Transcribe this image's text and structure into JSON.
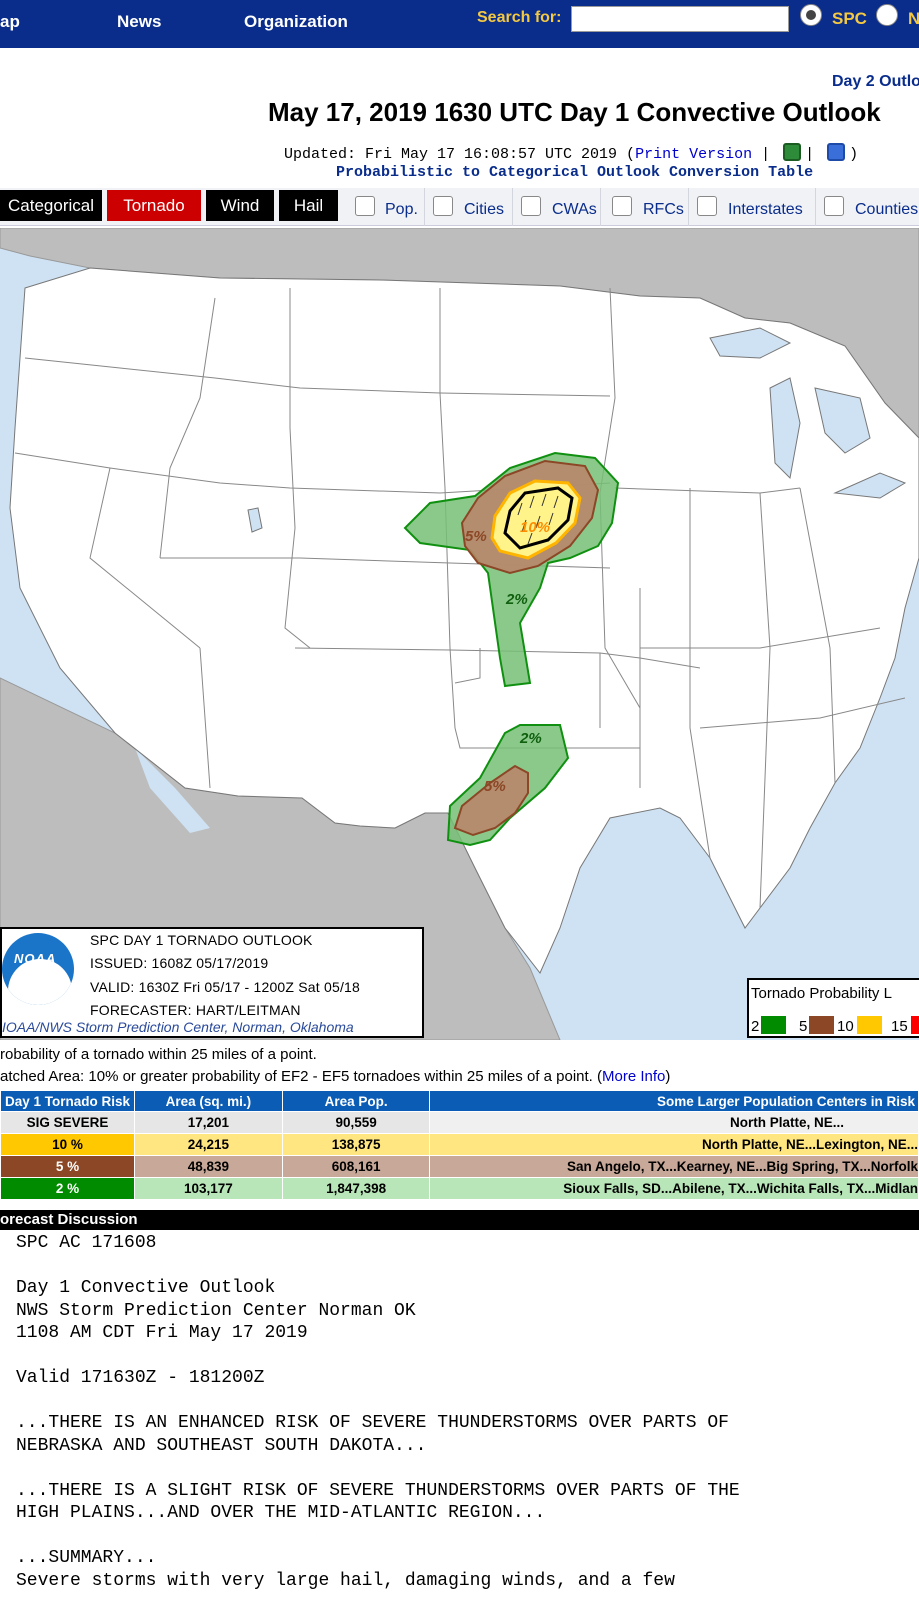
{
  "nav": {
    "links": [
      "ap",
      "News",
      "Organization"
    ],
    "search_label": "Search for:",
    "search_value": "",
    "radio_spc": "SPC",
    "radio_other": "N"
  },
  "header": {
    "day2_link": "Day 2 Outlo",
    "title": "May 17, 2019 1630 UTC Day 1 Convective Outlook",
    "updated_prefix": "Updated: Fri May 17 16:08:57 UTC 2019 (",
    "print_version": "Print Version",
    "updated_sep": " |",
    "updated_suffix": ")",
    "conversion_link": "Probabilistic to Categorical Outlook Conversion Table"
  },
  "tabs": {
    "categorical": "Categorical",
    "tornado": "Tornado",
    "wind": "Wind",
    "hail": "Hail",
    "overlays": [
      "Pop.",
      "Cities",
      "CWAs",
      "RFCs",
      "Interstates",
      "Counties"
    ]
  },
  "map": {
    "labels": {
      "ten": "10%",
      "five_north": "5%",
      "two_north": "2%",
      "two_south": "2%",
      "five_south": "5%"
    },
    "info": {
      "line1": "SPC DAY 1 TORNADO OUTLOOK",
      "line2": "ISSUED: 1608Z 05/17/2019",
      "line3": "VALID: 1630Z Fri 05/17 - 1200Z Sat 05/18",
      "line4": "FORECASTER: HART/LEITMAN",
      "footer": "IOAA/NWS Storm Prediction Center, Norman, Oklahoma",
      "logo_text": "NOAA"
    },
    "legend": {
      "title": "Tornado Probability L",
      "values": [
        "2",
        "5",
        "10",
        "15"
      ],
      "colors": [
        "#008b00",
        "#8b4726",
        "#ffc800",
        "#ff0000"
      ]
    }
  },
  "notes": {
    "line1": "robability of a tornado within 25 miles of a point.",
    "line2": "atched Area: 10% or greater probability of EF2 - EF5 tornadoes within 25 miles of a point. (",
    "more_info": "More Info",
    "line2_end": ")"
  },
  "risk_table": {
    "headers": [
      "Day 1 Tornado Risk",
      "Area (sq. mi.)",
      "Area Pop.",
      "Some Larger Population Centers in Risk"
    ],
    "rows": [
      {
        "risk": "SIG SEVERE",
        "area": "17,201",
        "pop": "90,559",
        "centers": "North Platte, NE..."
      },
      {
        "risk": "10 %",
        "area": "24,215",
        "pop": "138,875",
        "centers": "North Platte, NE...Lexington, NE..."
      },
      {
        "risk": "5 %",
        "area": "48,839",
        "pop": "608,161",
        "centers": "San Angelo, TX...Kearney, NE...Big Spring, TX...Norfolk"
      },
      {
        "risk": "2 %",
        "area": "103,177",
        "pop": "1,847,398",
        "centers": "Sioux Falls, SD...Abilene, TX...Wichita Falls, TX...Midlan"
      }
    ]
  },
  "discussion": {
    "header": "orecast Discussion",
    "text": "SPC AC 171608\n\nDay 1 Convective Outlook\nNWS Storm Prediction Center Norman OK\n1108 AM CDT Fri May 17 2019\n\nValid 171630Z - 181200Z\n\n...THERE IS AN ENHANCED RISK OF SEVERE THUNDERSTORMS OVER PARTS OF\nNEBRASKA AND SOUTHEAST SOUTH DAKOTA...\n\n...THERE IS A SLIGHT RISK OF SEVERE THUNDERSTORMS OVER PARTS OF THE\nHIGH PLAINS...AND OVER THE MID-ATLANTIC REGION...\n\n...SUMMARY...\nSevere storms with very large hail, damaging winds, and a few"
  },
  "colors": {
    "nav_bg": "#0a2d8c",
    "accent_yellow": "#f3c842",
    "tab_active": "#cc0000",
    "table_header": "#0a5cb5",
    "risk_2": "#008b00",
    "risk_5": "#8b4726",
    "risk_10": "#ffc800"
  }
}
